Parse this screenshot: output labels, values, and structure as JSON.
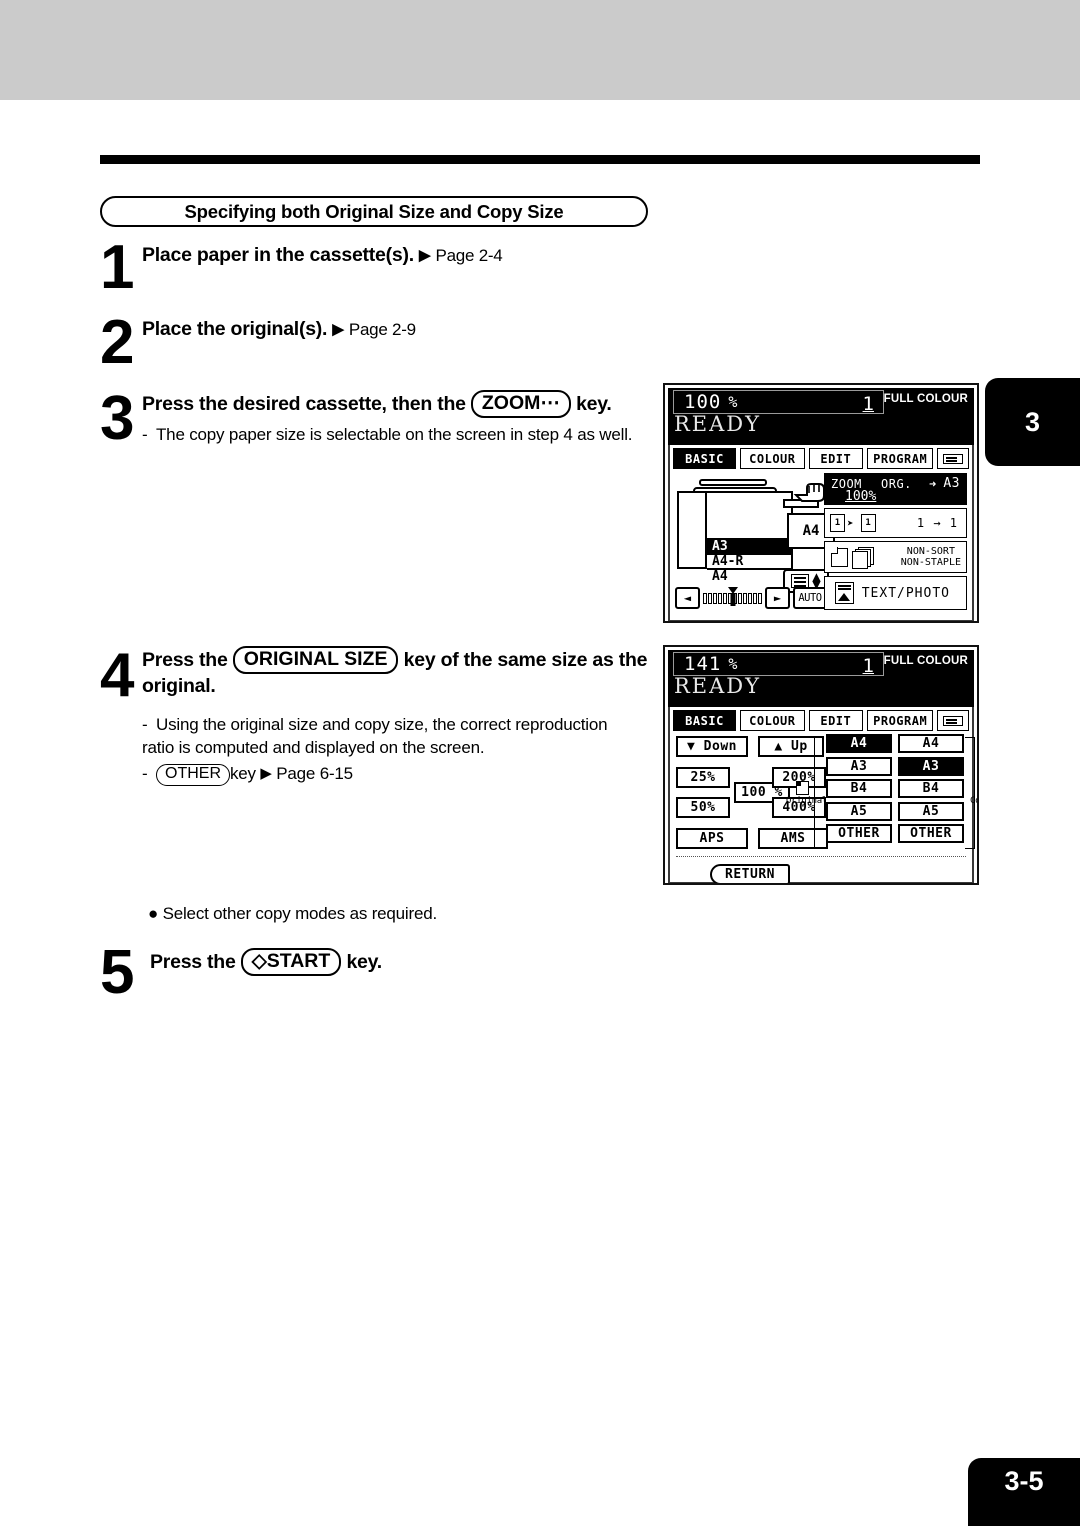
{
  "page": {
    "section_heading": "Specifying both Original Size and Copy Size",
    "side_tab_number": "3",
    "footer_page_number": "3-5"
  },
  "steps": [
    {
      "number": "1",
      "title": "Place paper in the cassette(s).",
      "arrow": "▶",
      "reference": "Page 2-4"
    },
    {
      "number": "2",
      "title": "Place the original(s).",
      "arrow": "▶",
      "reference": "Page 2-9"
    },
    {
      "number": "3",
      "title_before": "Press the desired cassette, then the",
      "key_label": "ZOOM⋯",
      "title_after": "key.",
      "note": "The copy paper size is selectable on the screen in step 4 as well."
    },
    {
      "number": "4",
      "title_before": "Press the",
      "key_label": "ORIGINAL SIZE",
      "title_after": "key of the same size as the original.",
      "note": "Using the original size and copy size, the correct reproduction ratio is computed and displayed on the screen.",
      "note2_key": "OTHER",
      "note2_text": "key",
      "note2_arrow": "▶",
      "note2_ref": "Page 6-15"
    },
    {
      "number": "5",
      "bullet": "● Select other copy modes as required.",
      "title_before": "Press the",
      "key_label": "◇START",
      "title_after": "key."
    }
  ],
  "lcd_panel_1": {
    "status": {
      "ratio": "100",
      "percent": "%",
      "copy_count": "1",
      "colour_mode": "FULL COLOUR",
      "ready_text": "READY"
    },
    "tabs": [
      {
        "label": "BASIC",
        "selected": true
      },
      {
        "label": "COLOUR",
        "selected": false
      },
      {
        "label": "EDIT",
        "selected": false
      },
      {
        "label": "PROGRAM",
        "selected": false
      },
      {
        "label": "",
        "icon": "list-icon",
        "selected": false
      }
    ],
    "cassettes": [
      {
        "label": "",
        "selected": false
      },
      {
        "label": "A3",
        "selected": true
      },
      {
        "label": "A4-R",
        "selected": false
      },
      {
        "label": "A4",
        "selected": false
      }
    ],
    "bypass_size": "A4",
    "auto_button": "AUTO",
    "zoom_row": {
      "left_label": "ZOOM",
      "mid_label": "ORG.",
      "arrow": "➜",
      "right_label": "A3",
      "value": "100%"
    },
    "duplex_row": {
      "label": "1 → 1"
    },
    "finish_row": {
      "line1": "NON-SORT",
      "line2": "NON-STAPLE"
    },
    "image_row": {
      "label": "TEXT/PHOTO"
    }
  },
  "lcd_panel_2": {
    "status": {
      "ratio": "141",
      "percent": "%",
      "copy_count": "1",
      "colour_mode": "FULL COLOUR",
      "ready_text": "READY"
    },
    "tabs": [
      {
        "label": "BASIC",
        "selected": true
      },
      {
        "label": "COLOUR",
        "selected": false
      },
      {
        "label": "EDIT",
        "selected": false
      },
      {
        "label": "PROGRAM",
        "selected": false
      },
      {
        "label": "",
        "icon": "list-icon",
        "selected": false
      }
    ],
    "ratio_buttons": {
      "down": "▼ Down",
      "up": "▲ Up",
      "p25": "25%",
      "p50": "50%",
      "p100": "100 %",
      "p200": "200%",
      "p400": "400%",
      "aps": "APS",
      "ams": "AMS",
      "return": "RETURN"
    },
    "original_label": "Original",
    "copy_label": "Copy",
    "original_sizes": [
      {
        "label": "A4",
        "selected": true
      },
      {
        "label": "A3",
        "selected": false
      },
      {
        "label": "B4",
        "selected": false
      },
      {
        "label": "A5",
        "selected": false
      },
      {
        "label": "OTHER",
        "selected": false
      }
    ],
    "copy_sizes": [
      {
        "label": "A4",
        "selected": false
      },
      {
        "label": "A3",
        "selected": true
      },
      {
        "label": "B4",
        "selected": false
      },
      {
        "label": "A5",
        "selected": false
      },
      {
        "label": "OTHER",
        "selected": false
      }
    ]
  }
}
